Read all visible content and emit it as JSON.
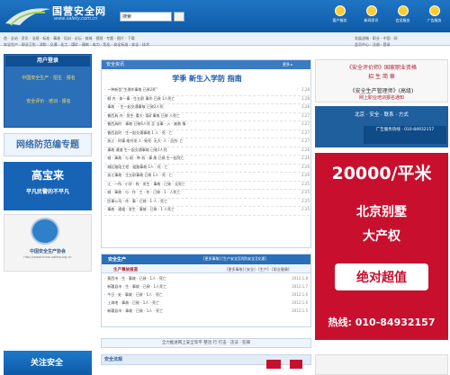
{
  "header": {
    "site_title": "国营安全网",
    "site_url": "www.safety.com.cn",
    "search_value": "搜索",
    "icons": [
      {
        "name": "home-icon",
        "label": "客户服务"
      },
      {
        "name": "contact-icon",
        "label": "新闻资讯"
      },
      {
        "name": "help-icon",
        "label": "会员服务"
      },
      {
        "name": "ad-icon",
        "label": "广告服务"
      }
    ]
  },
  "nav": {
    "row1": "首 · 全站 · 资讯 · 法规 · 标准 · 事故 · 培训 · 论坛 · 商城 · 视频 · 专题 · 图片 · 下载",
    "row1_right": "发展战略 · 职业 · 中国 · 网",
    "row2": "安全生产 · 职业卫生 · 消防 · 交通 · 化工 · 煤矿 · 建筑 · 电力 · 危化 · 安全标准 · 安全 · 技术",
    "row2_right": "会员中心 · 注册 · 登录"
  },
  "left": {
    "box1_title": "用户登录",
    "box1_sub": "中国安全生产 · 招生 · 报名",
    "box1_sub2": "安全评价 · 培训 · 报名",
    "banner": "网络防范编专题",
    "promo_title": "高宝来",
    "promo_sub": "平凡民警的不平凡",
    "assoc_name": "中国安全生产协会",
    "assoc_url": "http://www.china-safety.org.cn",
    "bottom": "关注安全"
  },
  "news": {
    "section": "安全资讯",
    "more": "更多 ▸",
    "headline": "学季 新生入学防 指南",
    "items": [
      {
        "t": "一种新型“生理作事故 已致2死”",
        "d": "2.28"
      },
      {
        "t": "柳 内 · 体一事 · 生五职 事作 已致 1人死亡",
        "d": "2.28"
      },
      {
        "t": "事故 ·  · 生一起交通事故 已致2人死",
        "d": "2.28"
      },
      {
        "t": "鲁西具 内 · 发生· 重大· 煤矿事故 已致 人死亡",
        "d": "2.27"
      },
      {
        "t": "鲁西具时 · 事故 已致6人死 至 当事 · 入 · 被救 情 ·",
        "d": "2.27"
      },
      {
        "t": "鲁西县时 · 生一起交通事故 1 人 · 死 · 亡",
        "d": "2.27"
      },
      {
        "t": "浙江 · 时事 故共发·人· 致死· 无大· 人 · 员伤· 亡",
        "d": "2.27"
      },
      {
        "t": "事故 通道 生一起交通事故 已致1人死",
        "d": "2.26"
      },
      {
        "t": "城 · 事故 · 与 职 · 种 机 · 事 故 已致 生一起死亡",
        "d": "2.26"
      },
      {
        "t": "城区路段工程 · 道路事故 1人 · 死 · 亡",
        "d": "2.26"
      },
      {
        "t": "浙江事故 · 生五职事故 已致 1人 · 死 · 亡",
        "d": "2.26"
      },
      {
        "t": "江 · 一所 · 小学 · 校 · 发生 · 事故 · 已致 · 无死亡",
        "d": "2.25"
      },
      {
        "t": "城 · 事故 · 与 · 作 · 工 · 作 · 已致 · 1 · 人死亡",
        "d": "2.25"
      },
      {
        "t": "民事公司 · 作 · 事 · 已致 · 1 人 · 死亡",
        "d": "2.25"
      },
      {
        "t": "事故 · 通道 · 发生 · 事故 · 已致 · 1 人死亡",
        "d": "2.25"
      }
    ]
  },
  "sec2": {
    "label": "安全生产",
    "tabs": "[更多事故]  [生产安全][消防安全][交通]",
    "subtitle": "生产事故报道",
    "subright": "[更多事故]  [安全] · [生产] · [职业健康]",
    "items": [
      {
        "t": "黄西市 · 生 · 事故 · 已致 · 1人 · 死亡",
        "d": "2012.1.8"
      },
      {
        "t": "新疆县市 · 生 · 事故 · 已致 · 1人死亡",
        "d": "2012.1.7"
      },
      {
        "t": "今日 · 处 · 事故 · 已致 · 1人 · 死亡",
        "d": "2012.1.6"
      },
      {
        "t": "上海地 · 事故 · 已致 · 1人 · 死亡",
        "d": "2012.1.6"
      },
      {
        "t": "新疆县市 · 事故 · 已致 · 1人 · 死亡",
        "d": "2012.1.5"
      }
    ]
  },
  "footer": {
    "links": "全力推进网上安全等平  整治  行  打击 · 违法 · 犯罪",
    "bottom_tab": "安全法规"
  },
  "right": {
    "ad1_line1": "《安全评价师》国家职业资格",
    "ad1_line2": "招 生 简 章",
    "ad1_line3": "《安全生产管理师》(高级)",
    "ad1_line4": "网上职业培训报名通知",
    "ad2_text": "北京 · 安全 · 联系 · 方式",
    "ad2_phone": "广告服务热线 · 010-84932157",
    "bigad_price": "20000/平米",
    "bigad_l1": "北京别墅",
    "bigad_l2": "大产权",
    "bigad_badge": "绝对超值",
    "bigad_tel": "热线: 010-84932157"
  },
  "colors": {
    "primary": "#1f75c4",
    "ad_red": "#c8102e",
    "accent": "#2b6fb8"
  }
}
